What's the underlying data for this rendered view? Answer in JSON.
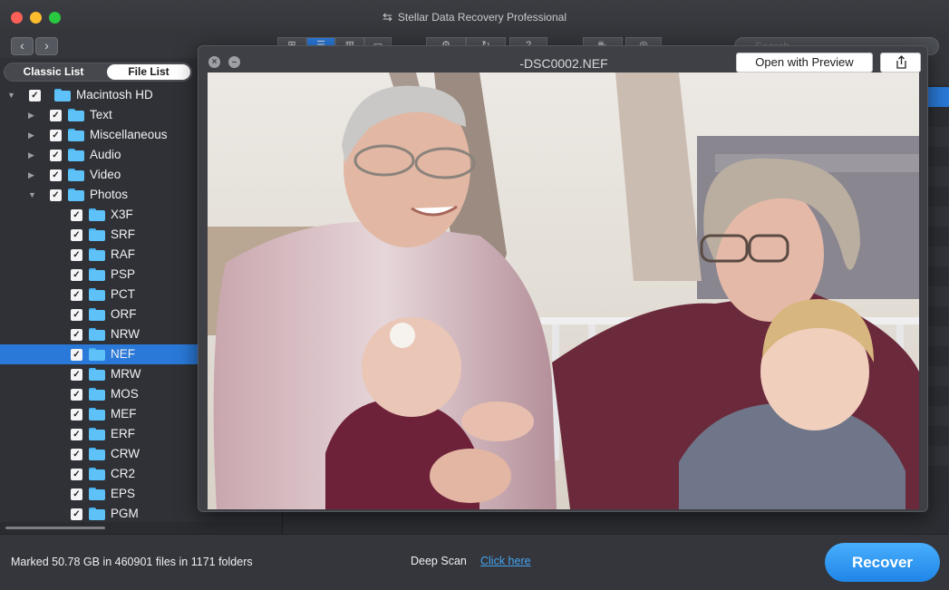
{
  "window": {
    "title": "Stellar Data Recovery Professional"
  },
  "toolbar": {
    "back": "‹",
    "forward": "›",
    "search_placeholder": "Search"
  },
  "sidebar": {
    "tabs": {
      "classic": "Classic List",
      "file": "File List"
    },
    "tree": [
      {
        "label": "Macintosh HD",
        "level": 0,
        "disclosure": "▼",
        "checked": true
      },
      {
        "label": "Text",
        "level": 1,
        "disclosure": "▶",
        "checked": true
      },
      {
        "label": "Miscellaneous",
        "level": 1,
        "disclosure": "▶",
        "checked": true
      },
      {
        "label": "Audio",
        "level": 1,
        "disclosure": "▶",
        "checked": true
      },
      {
        "label": "Video",
        "level": 1,
        "disclosure": "▶",
        "checked": true
      },
      {
        "label": "Photos",
        "level": 1,
        "disclosure": "▼",
        "checked": true
      },
      {
        "label": "X3F",
        "level": 2,
        "checked": true
      },
      {
        "label": "SRF",
        "level": 2,
        "checked": true
      },
      {
        "label": "RAF",
        "level": 2,
        "checked": true
      },
      {
        "label": "PSP",
        "level": 2,
        "checked": true
      },
      {
        "label": "PCT",
        "level": 2,
        "checked": true
      },
      {
        "label": "ORF",
        "level": 2,
        "checked": true
      },
      {
        "label": "NRW",
        "level": 2,
        "checked": true
      },
      {
        "label": "NEF",
        "level": 2,
        "checked": true,
        "selected": true
      },
      {
        "label": "MRW",
        "level": 2,
        "checked": true
      },
      {
        "label": "MOS",
        "level": 2,
        "checked": true
      },
      {
        "label": "MEF",
        "level": 2,
        "checked": true
      },
      {
        "label": "ERF",
        "level": 2,
        "checked": true
      },
      {
        "label": "CRW",
        "level": 2,
        "checked": true
      },
      {
        "label": "CR2",
        "level": 2,
        "checked": true
      },
      {
        "label": "EPS",
        "level": 2,
        "checked": true
      },
      {
        "label": "PGM",
        "level": 2,
        "checked": true
      }
    ]
  },
  "preview": {
    "title": "-DSC0002.NEF",
    "open_with_preview": "Open with Preview"
  },
  "status": {
    "marked": "Marked 50.78 GB in 460901 files in 1171 folders",
    "deep_scan": "Deep Scan",
    "click_here": "Click here",
    "recover": "Recover"
  },
  "colors": {
    "accent": "#2a79d8",
    "folder": "#5ec1f7",
    "link": "#46a4f0"
  }
}
